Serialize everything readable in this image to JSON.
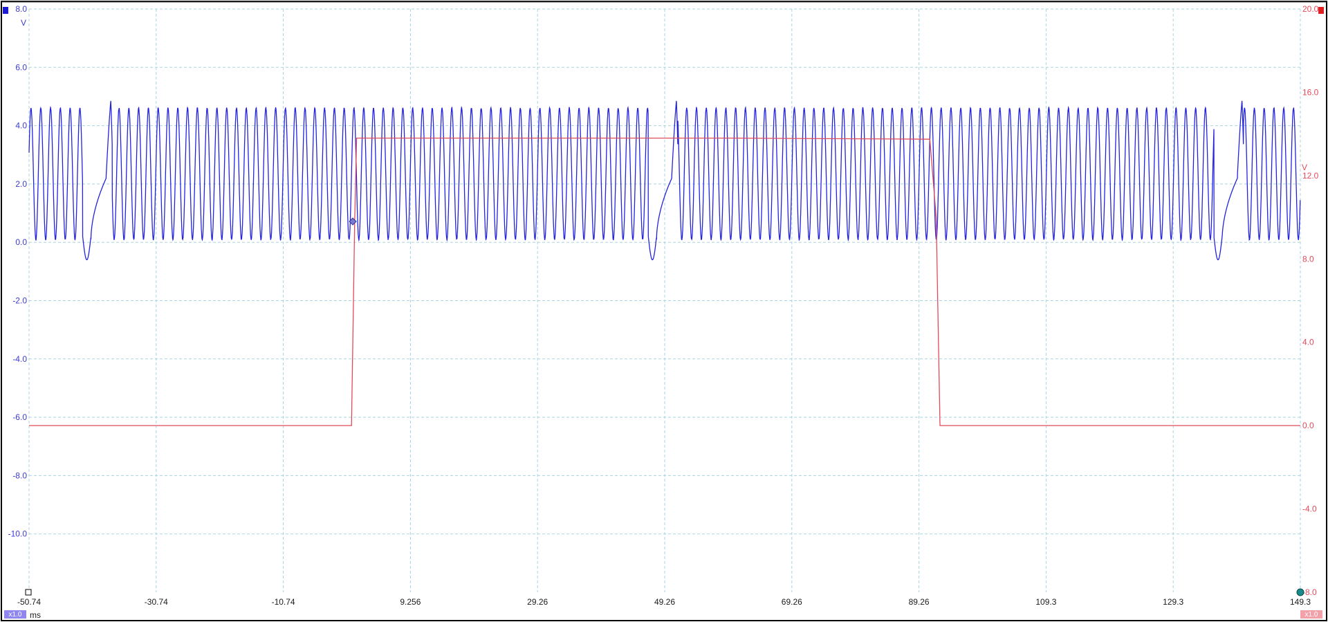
{
  "chart_data": {
    "type": "line",
    "x_unit": "ms",
    "xlim": [
      -50.74,
      149.3
    ],
    "x_ticks": [
      "-50.74",
      "-30.74",
      "-10.74",
      "9.256",
      "29.26",
      "49.26",
      "69.26",
      "89.26",
      "109.3",
      "129.3",
      "149.3"
    ],
    "grid": true,
    "axes": {
      "left": {
        "unit": "V",
        "ylim": [
          -12.0,
          8.0
        ],
        "ticks": [
          "8.0",
          "6.0",
          "4.0",
          "2.0",
          "0.0",
          "-2.0",
          "-4.0",
          "-6.0",
          "-8.0",
          "-10.0"
        ],
        "color": "#2222dd"
      },
      "right": {
        "unit": "V",
        "ylim": [
          -8.0,
          20.0
        ],
        "ticks": [
          "20.0",
          "16.0",
          "12.0",
          "8.0",
          "4.0",
          "0.0",
          "-4.0",
          "-8.0"
        ],
        "color": "#e24a5a"
      }
    },
    "series": [
      {
        "axis": "left",
        "color": "#2222dd",
        "kind": "periodic-oscillation",
        "low": 0.1,
        "high": 4.6,
        "cycle_ms": 1.54,
        "trigger_gap_times_ms": [
          -40.0,
          49.0,
          138.0
        ],
        "gap_peak": 5.45,
        "gap_trough": -0.6
      },
      {
        "axis": "right",
        "color": "#e24a5a",
        "kind": "pulse",
        "points": [
          [
            -50.74,
            0.0
          ],
          [
            0.0,
            0.0
          ],
          [
            0.5,
            9.8
          ],
          [
            0.8,
            13.8
          ],
          [
            30.0,
            13.8
          ],
          [
            60.0,
            13.8
          ],
          [
            91.0,
            13.75
          ],
          [
            92.0,
            10.0
          ],
          [
            92.6,
            0.0
          ],
          [
            149.3,
            0.0
          ]
        ]
      }
    ],
    "trigger_marker": {
      "x": 0.2,
      "y_right": 9.8
    }
  },
  "ui": {
    "left_channel_color": "#1a1ad0",
    "right_channel_color": "#e02020",
    "left_zoom_label": "x1.0",
    "right_zoom_label": "x1.0"
  }
}
